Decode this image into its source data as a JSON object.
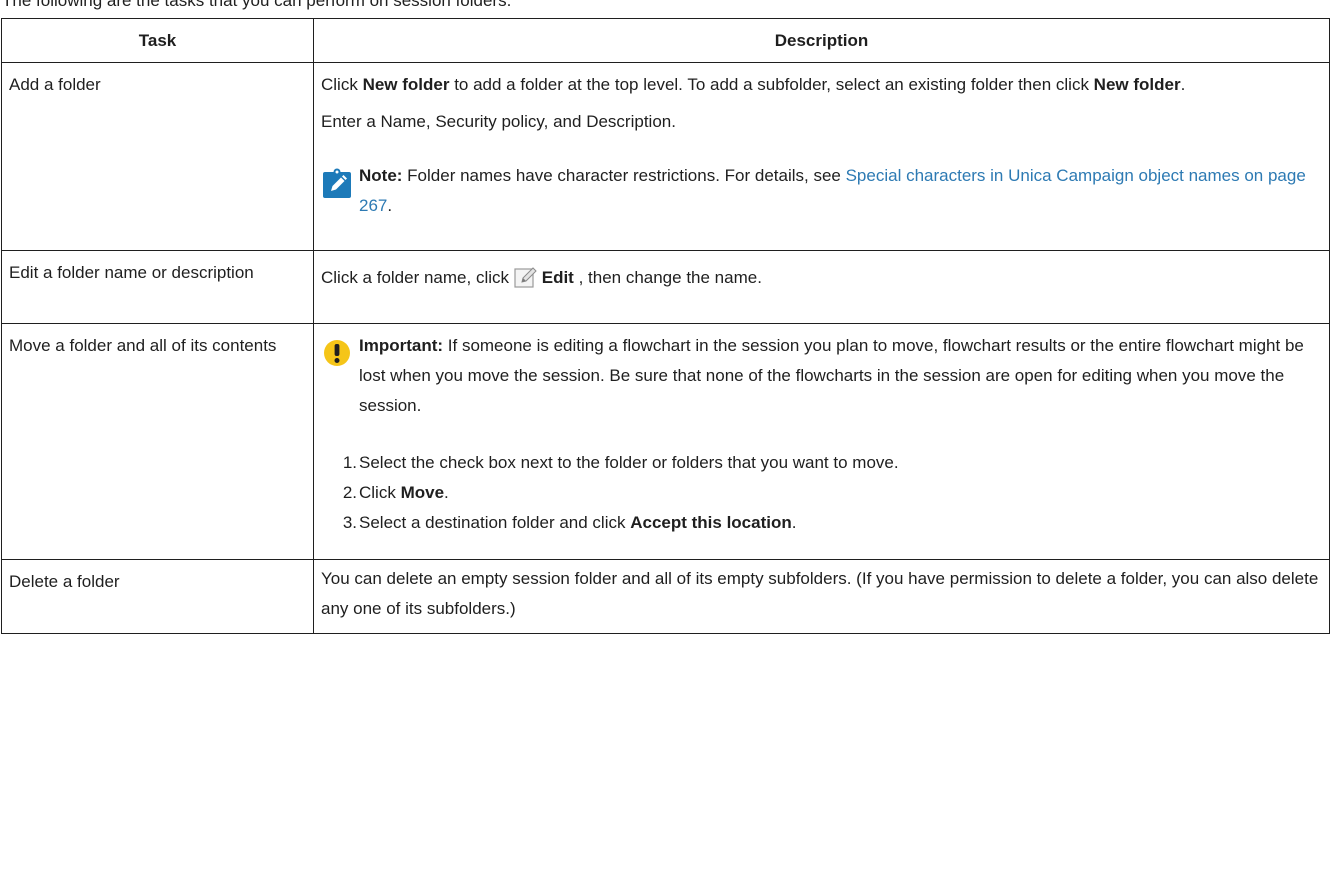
{
  "caption": "The following are the tasks that you can perform on session folders.",
  "table": {
    "headers": {
      "task": "Task",
      "description": "Description"
    },
    "rows": {
      "add": {
        "task": "Add a folder",
        "p1": {
          "t1": "Click ",
          "b1": "New folder",
          "t2": " to add a folder at the top level. To add a subfolder, select an existing folder then click ",
          "b2": "New folder",
          "t3": "."
        },
        "p2": "Enter a Name, Security policy, and Description.",
        "note": {
          "label": "Note:",
          "text": " Folder names have character restrictions. For details, see ",
          "link": "Special characters in Unica Campaign object names on page 267",
          "end": ".",
          "icon": "pencil-note-icon",
          "icon_color": "#1d7ab9"
        }
      },
      "edit": {
        "task": "Edit a folder name or description",
        "t1": "Click a folder name, click ",
        "icon": "edit-icon",
        "b1": "Edit",
        "t2": " , then change the name."
      },
      "move": {
        "task": "Move a folder and all of its contents",
        "important": {
          "label": "Important:",
          "text": " If someone is editing a flowchart in the session you plan to move, flowchart results or the entire flowchart might be lost when you move the session. Be sure that none of the flowcharts in the session are open for editing when you move the session.",
          "icon": "exclamation-icon",
          "icon_color": "#f5c518"
        },
        "steps": [
          {
            "num": "1.",
            "text": "Select the check box next to the folder or folders that you want to move."
          },
          {
            "num": "2.",
            "text": "Click ",
            "bold": "Move",
            "end": "."
          },
          {
            "num": "3.",
            "text": "Select a destination folder and click ",
            "bold": "Accept this location",
            "end": "."
          }
        ]
      },
      "delete": {
        "task": "Delete a folder",
        "text": "You can delete an empty session folder and all of its empty subfolders. (If you have permission to delete a folder, you can also delete any one of its subfolders.)"
      }
    }
  }
}
